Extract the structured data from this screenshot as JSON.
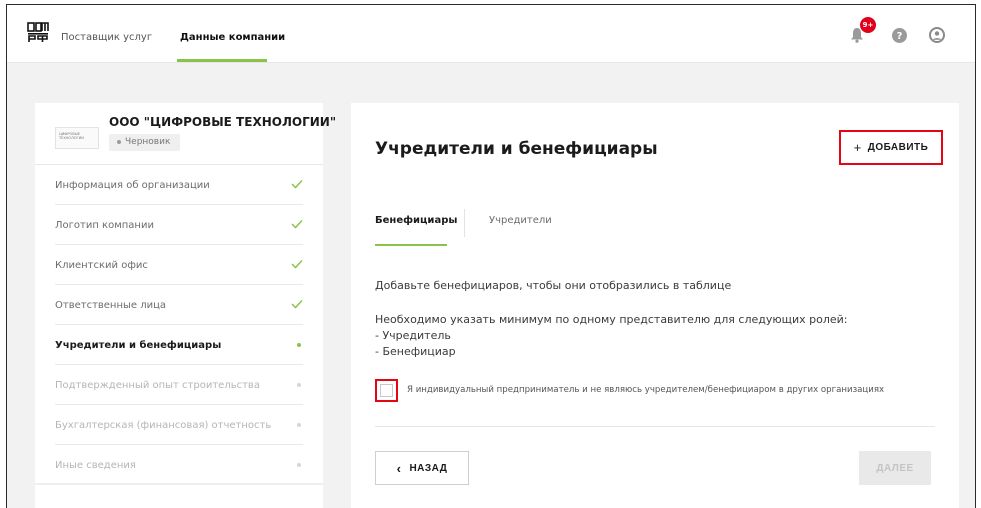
{
  "header": {
    "logo_text": "ДОМ РФ",
    "nav": [
      {
        "label": "Поставщик услуг"
      },
      {
        "label": "Данные компании"
      }
    ],
    "notifications_badge": "9+",
    "colors": {
      "accent": "#8bc34a",
      "badge": "#e0001b",
      "highlight": "#e30613"
    }
  },
  "sidebar": {
    "company": {
      "name": "ООО \"ЦИФРОВЫЕ ТЕХНОЛОГИИ\"",
      "logo_text": "ЦИФРОВЫЕ ТЕХНОЛОГИИ",
      "status": "Черновик"
    },
    "items": [
      {
        "label": "Информация об организации",
        "state": "done",
        "icon": "check-icon"
      },
      {
        "label": "Логотип компании",
        "state": "done",
        "icon": "check-icon"
      },
      {
        "label": "Клиентский офис",
        "state": "done",
        "icon": "check-icon"
      },
      {
        "label": "Ответственные лица",
        "state": "done",
        "icon": "check-icon"
      },
      {
        "label": "Учредители и бенефициары",
        "state": "current",
        "icon": "dot-icon"
      },
      {
        "label": "Подтвержденный опыт строительства",
        "state": "pending",
        "icon": "dot-icon"
      },
      {
        "label": "Бухгалтерская (финансовая) отчетность",
        "state": "pending",
        "icon": "dot-icon"
      },
      {
        "label": "Иные сведения",
        "state": "pending",
        "icon": "dot-icon"
      }
    ]
  },
  "main": {
    "title": "Учредители и бенефициары",
    "add_button": {
      "icon": "+",
      "label": "ДОБАВИТЬ"
    },
    "tabs": [
      {
        "label": "Бенефициары",
        "active": true
      },
      {
        "label": "Учредители",
        "active": false
      }
    ],
    "empty_message": "Добавьте бенефициаров, чтобы они отобразились в таблице",
    "requirement_message": "Необходимо указать минимум по одному представителю для следующих ролей:",
    "roles": [
      "- Учредитель",
      "- Бенефициар"
    ],
    "checkbox_label": "Я индивидуальный предприниматель и не являюсь учредителем/бенефициаром в других организациях",
    "back_button": {
      "icon": "‹",
      "label": "НАЗАД"
    },
    "next_button": {
      "label": "ДАЛЕЕ"
    }
  }
}
